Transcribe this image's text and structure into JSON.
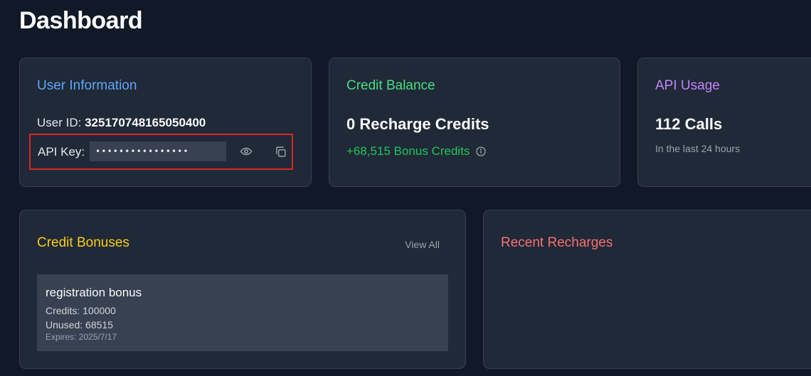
{
  "page": {
    "title": "Dashboard"
  },
  "user_info": {
    "title": "User Information",
    "user_id_label": "User ID:",
    "user_id": "325170748165050400",
    "api_key_label": "API Key:",
    "api_key_masked": "••••••••••••••••",
    "show_icon": "eye-icon",
    "copy_icon": "copy-icon"
  },
  "credit_balance": {
    "title": "Credit Balance",
    "value": "0 Recharge Credits",
    "bonus": "+68,515 Bonus Credits",
    "info_icon": "info-icon"
  },
  "api_usage": {
    "title": "API Usage",
    "value": "112 Calls",
    "note": "In the last 24 hours"
  },
  "credit_bonuses": {
    "title": "Credit Bonuses",
    "view_all": "View All",
    "items": [
      {
        "name": "registration bonus",
        "credits": "Credits: 100000",
        "unused": "Unused: 68515",
        "expires": "Expires: 2025/7/17"
      }
    ]
  },
  "recent_recharges": {
    "title": "Recent Recharges"
  },
  "colors": {
    "background": "#111827",
    "card": "#1f2937",
    "blue_title": "#60a5fa",
    "green_title": "#4ade80",
    "purple_title": "#c084fc",
    "yellow_title": "#facc15",
    "red_title": "#f87171",
    "highlight_border": "#dc2626"
  }
}
